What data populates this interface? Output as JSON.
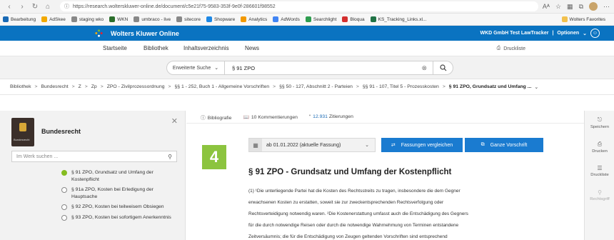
{
  "browser": {
    "url": "https://research.wolterskluwer-online.de/document/c5e21f75-9583-353f-9e0f-286601f98552",
    "zoom": "Aᴬ",
    "bookmarks": [
      {
        "label": "Bearbeitung",
        "color": "#1a6ab5"
      },
      {
        "label": "AdSkee",
        "color": "#f2a900"
      },
      {
        "label": "staging wko",
        "color": "#888888"
      },
      {
        "label": "WKN",
        "color": "#2b6e2b"
      },
      {
        "label": "umbraco - live",
        "color": "#888888"
      },
      {
        "label": "sitecore",
        "color": "#888888"
      },
      {
        "label": "Shopware",
        "color": "#1e88e5"
      },
      {
        "label": "Analytics",
        "color": "#f29900"
      },
      {
        "label": "AdWords",
        "color": "#4285f4"
      },
      {
        "label": "Searchlight",
        "color": "#2e9d4f"
      },
      {
        "label": "Bloqua",
        "color": "#d32f2f"
      },
      {
        "label": "KS_Tracking_Links.xl...",
        "color": "#217346"
      }
    ],
    "bookmark_right": "Wolters Favorites"
  },
  "header": {
    "app_title": "Wolters Kluwer Online",
    "account": "WKD GmbH Test LawTracker",
    "options": "Optionen",
    "brand_color": "#0a73c1"
  },
  "nav": {
    "items": [
      "Startseite",
      "Bibliothek",
      "Inhaltsverzeichnis",
      "News"
    ],
    "druckliste": "Druckliste"
  },
  "search": {
    "advanced_label": "Erweiterte Suche",
    "query": "§ 91 ZPO"
  },
  "breadcrumb": [
    "Bibliothek",
    "Bundesrecht",
    "Z",
    "Zp",
    "ZPO - Zivilprozessordnung",
    "§§ 1 - 252, Buch 1 - Allgemeine Vorschriften",
    "§§ 50 - 127, Abschnitt 2 - Parteien",
    "§§ 91 - 107, Titel 5 - Prozesskosten",
    "§ 91 ZPO, Grundsatz und Umfang ..."
  ],
  "sidebar": {
    "title": "Bundesrecht",
    "book_label": "Bundesrecht",
    "search_placeholder": "Im Werk suchen ...",
    "toc": [
      {
        "label": "§ 91 ZPO, Grundsatz und Umfang der Kostenpflicht",
        "active": true
      },
      {
        "label": "§ 91a ZPO, Kosten bei Erledigung der Hauptsache",
        "active": false
      },
      {
        "label": "§ 92 ZPO, Kosten bei teilweisem Obsiegen",
        "active": false
      },
      {
        "label": "§ 93 ZPO, Kosten bei sofortigem Anerkenntnis",
        "active": false
      }
    ],
    "active_color": "#85bc20"
  },
  "document": {
    "meta": {
      "bibliografie": "Bibliografie",
      "kommentierungen": "10 Kommentierungen",
      "zitierungen_count": "12.931",
      "zitierungen_label": "Zitierungen"
    },
    "version": "ab 01.01.2022 (aktuelle Fassung)",
    "compare_button": "Fassungen vergleichen",
    "whole_button": "Ganze Vorschrift",
    "badge": "4",
    "badge_color": "#8cc43f",
    "title": "§ 91 ZPO - Grundsatz und Umfang der Kostenpflicht",
    "body": [
      "(1) ¹Die unterliegende Partei hat die Kosten des Rechtsstreits zu tragen, insbesondere die dem Gegner",
      "erwachsenen Kosten zu erstatten, soweit sie zur zweckentsprechenden Rechtsverfolgung oder",
      "Rechtsverteidigung notwendig waren. ²Die Kostenerstattung umfasst auch die Entschädigung des Gegners",
      "für die durch notwendige Reisen oder durch die notwendige Wahrnehmung von Terminen entstandene",
      "Zeitversäumnis; die für die Entschädigung von Zeugen geltenden Vorschriften sind entsprechend"
    ]
  },
  "rail": {
    "items": [
      "Speichern",
      "Drucken",
      "Druckliste",
      "Rechtsgriff"
    ]
  }
}
